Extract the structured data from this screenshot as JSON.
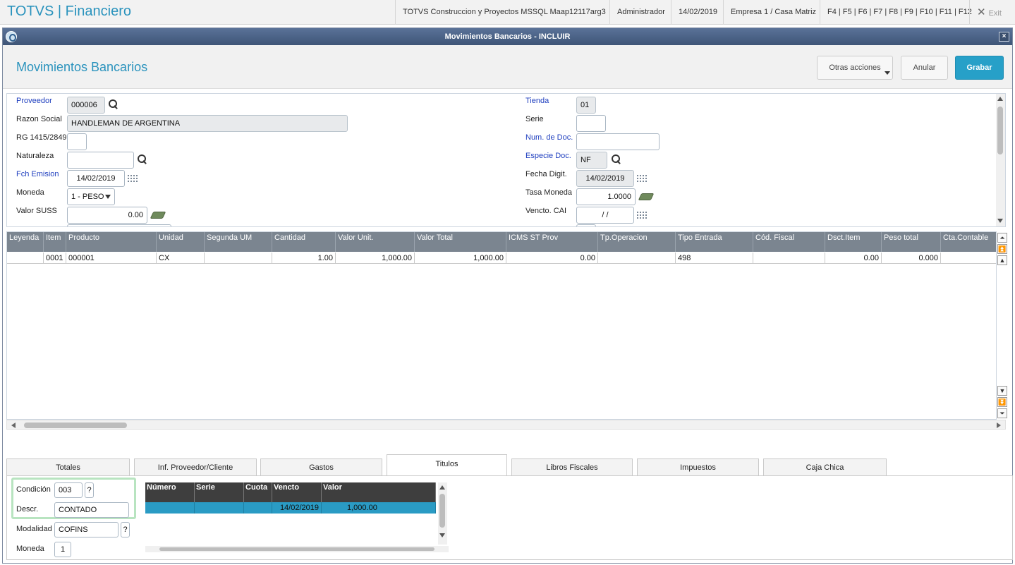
{
  "topbar": {
    "app_title": "TOTVS | Financiero",
    "environment": "TOTVS Construccion y Proyectos MSSQL Maap12117arg3",
    "user": "Administrador",
    "date": "14/02/2019",
    "company": "Empresa 1 / Casa Matriz",
    "shortcuts": "F4 | F5 | F6 | F7 | F8 | F9 | F10 | F11 | F12",
    "exit_label": "Exit"
  },
  "dialog": {
    "title": "Movimientos Bancarios - INCLUIR",
    "close_glyph": "×",
    "page_title": "Movimientos Bancarios",
    "buttons": {
      "otras": "Otras acciones",
      "anular": "Anular",
      "grabar": "Grabar"
    }
  },
  "form": {
    "proveedor": {
      "label": "Proveedor",
      "value": "000006"
    },
    "razon_social": {
      "label": "Razon Social",
      "value": "HANDLEMAN DE ARGENTINA"
    },
    "rg": {
      "label": "RG 1415/2849",
      "value": ""
    },
    "naturaleza": {
      "label": "Naturaleza",
      "value": ""
    },
    "fch_emision": {
      "label": "Fch Emision",
      "value": "14/02/2019"
    },
    "moneda": {
      "label": "Moneda",
      "value": "1 - PESO"
    },
    "valor_suss": {
      "label": "Valor SUSS",
      "value": "0.00"
    },
    "tienda": {
      "label": "Tienda",
      "value": "01"
    },
    "serie": {
      "label": "Serie",
      "value": ""
    },
    "num_doc": {
      "label": "Num. de Doc.",
      "value": ""
    },
    "especie_doc": {
      "label": "Especie Doc.",
      "value": "NF"
    },
    "fecha_digit": {
      "label": "Fecha Digit.",
      "value": "14/02/2019"
    },
    "tasa_moneda": {
      "label": "Tasa Moneda",
      "value": "1.0000"
    },
    "vencto_cai": {
      "label": "Vencto. CAI",
      "value": "/ /"
    }
  },
  "grid": {
    "headers": [
      "Leyenda",
      "Item",
      "Producto",
      "Unidad",
      "Segunda UM",
      "Cantidad",
      "Valor Unit.",
      "Valor Total",
      "ICMS ST Prov",
      "Tp.Operacion",
      "Tipo Entrada",
      "Cód. Fiscal",
      "Dsct.Item",
      "Peso total",
      "Cta.Contable"
    ],
    "rows": [
      [
        "",
        "0001",
        "000001",
        "CX",
        "",
        "1.00",
        "1,000.00",
        "1,000.00",
        "0.00",
        "",
        "498",
        "",
        "0.00",
        "0.000",
        ""
      ]
    ]
  },
  "tabs": [
    "Totales",
    "Inf. Proveedor/Cliente",
    "Gastos",
    "Titulos",
    "Libros Fiscales",
    "Impuestos",
    "Caja Chica"
  ],
  "active_tab": "Titulos",
  "titulos": {
    "condicion": {
      "label": "Condición",
      "value": "003",
      "help": "?"
    },
    "descr": {
      "label": "Descr.",
      "value": "CONTADO"
    },
    "modalidad": {
      "label": "Modalidad",
      "value": "COFINS",
      "help": "?"
    },
    "moneda": {
      "label": "Moneda",
      "value": "1"
    },
    "grid_headers": [
      "Número",
      "Serie",
      "Cuota",
      "Vencto",
      "Valor"
    ],
    "grid_rows": [
      [
        "",
        "",
        "",
        "14/02/2019",
        "1,000.00"
      ]
    ]
  },
  "colors": {
    "accent": "#2a93bd",
    "button_primary": "#27a0c8",
    "title_bar": "#4a6388",
    "grid_header": "#7b8590",
    "selected_row": "#2a9bc4",
    "highlight": "#b8e4c0"
  }
}
